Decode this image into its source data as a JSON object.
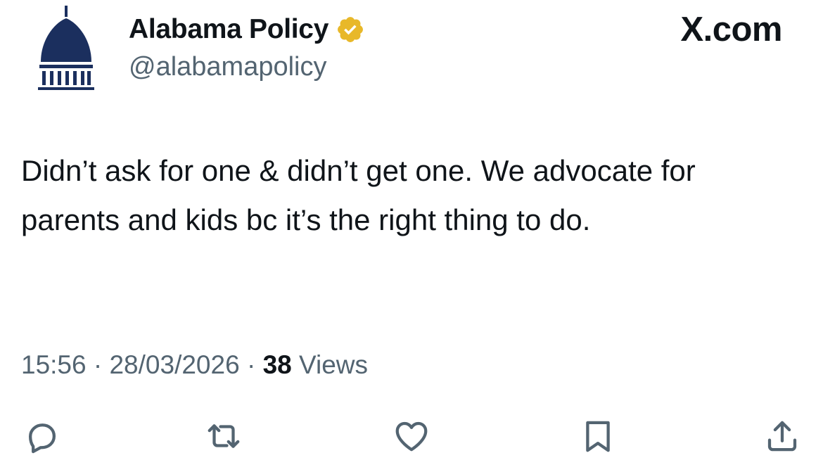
{
  "author": {
    "display_name": "Alabama Policy",
    "handle": "@alabamapolicy",
    "avatar_icon": "capitol-dome-icon",
    "verified_icon": "verified-badge-icon",
    "verified_color": "#E8B829",
    "avatar_color": "#1B2F5E"
  },
  "brand": {
    "label": "X.com"
  },
  "tweet": {
    "text": "Didn’t ask for one & didn’t get one. We advocate for parents and kids bc it’s the right thing to do."
  },
  "meta": {
    "time": "15:56",
    "separator": "·",
    "date": "28/03/2026",
    "views_count": "38",
    "views_label": "Views"
  },
  "actions": [
    {
      "name": "reply",
      "icon": "reply-icon"
    },
    {
      "name": "retweet",
      "icon": "retweet-icon"
    },
    {
      "name": "like",
      "icon": "heart-icon"
    },
    {
      "name": "bookmark",
      "icon": "bookmark-icon"
    },
    {
      "name": "share",
      "icon": "share-icon"
    }
  ],
  "colors": {
    "text_primary": "#0F1419",
    "text_secondary": "#536471",
    "icon_gray": "#536471"
  }
}
